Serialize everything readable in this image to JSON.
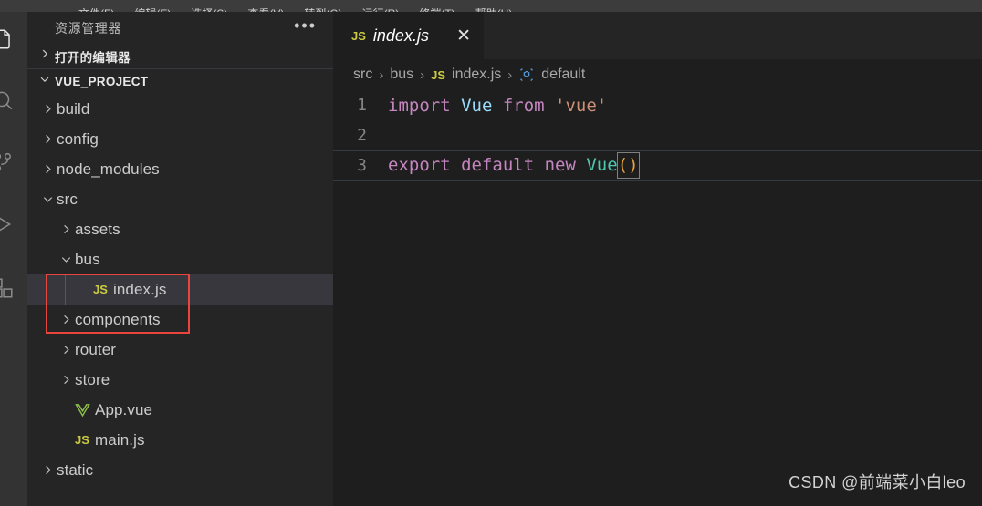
{
  "menubar": {
    "items": [
      "文件(F)",
      "编辑(E)",
      "选择(S)",
      "查看(V)",
      "转到(G)",
      "运行(R)",
      "终端(T)",
      "帮助(H)"
    ]
  },
  "activitybar": {
    "items": [
      {
        "name": "explorer-icon",
        "label": "资源管理器",
        "active": true
      },
      {
        "name": "search-icon",
        "label": "搜索",
        "active": false
      },
      {
        "name": "source-control-icon",
        "label": "源代码管理",
        "active": false
      },
      {
        "name": "run-debug-icon",
        "label": "运行和调试",
        "active": false
      },
      {
        "name": "extensions-icon",
        "label": "扩展",
        "active": false
      }
    ]
  },
  "sidebar": {
    "title": "资源管理器",
    "more_actions": "•••",
    "open_editors": {
      "label": "打开的编辑器",
      "expanded": false
    },
    "project": {
      "label": "VUE_PROJECT",
      "expanded": true
    },
    "tree": [
      {
        "label": "build",
        "type": "folder",
        "expanded": false,
        "depth": 1,
        "selected": false
      },
      {
        "label": "config",
        "type": "folder",
        "expanded": false,
        "depth": 1,
        "selected": false
      },
      {
        "label": "node_modules",
        "type": "folder",
        "expanded": false,
        "depth": 1,
        "selected": false
      },
      {
        "label": "src",
        "type": "folder",
        "expanded": true,
        "depth": 1,
        "selected": false
      },
      {
        "label": "assets",
        "type": "folder",
        "expanded": false,
        "depth": 2,
        "selected": false
      },
      {
        "label": "bus",
        "type": "folder",
        "expanded": true,
        "depth": 2,
        "selected": false
      },
      {
        "label": "index.js",
        "type": "js",
        "depth": 3,
        "selected": true
      },
      {
        "label": "components",
        "type": "folder",
        "expanded": false,
        "depth": 2,
        "selected": false
      },
      {
        "label": "router",
        "type": "folder",
        "expanded": false,
        "depth": 2,
        "selected": false
      },
      {
        "label": "store",
        "type": "folder",
        "expanded": false,
        "depth": 2,
        "selected": false
      },
      {
        "label": "App.vue",
        "type": "vue",
        "depth": 2,
        "selected": false
      },
      {
        "label": "main.js",
        "type": "js",
        "depth": 2,
        "selected": false
      },
      {
        "label": "static",
        "type": "folder",
        "expanded": false,
        "depth": 1,
        "selected": false
      }
    ]
  },
  "editor": {
    "tab": {
      "label": "index.js",
      "filetype_badge": "JS",
      "close": "✕",
      "preview": true
    },
    "breadcrumbs": [
      {
        "label": "src",
        "icon": ""
      },
      {
        "label": "bus",
        "icon": ""
      },
      {
        "label": "index.js",
        "icon": "js-badge"
      },
      {
        "label": "default",
        "icon": "module-cube-icon"
      }
    ],
    "breadcrumb_separator": "›",
    "lines": [
      {
        "number": "1",
        "tokens": [
          {
            "text": "import ",
            "kind": "keyword"
          },
          {
            "text": "Vue ",
            "kind": "variable"
          },
          {
            "text": "from ",
            "kind": "keyword"
          },
          {
            "text": "'vue'",
            "kind": "string"
          }
        ],
        "current": false
      },
      {
        "number": "2",
        "tokens": [],
        "current": false
      },
      {
        "number": "3",
        "tokens": [
          {
            "text": "export ",
            "kind": "keyword"
          },
          {
            "text": "default ",
            "kind": "keyword"
          },
          {
            "text": "new ",
            "kind": "keyword"
          },
          {
            "text": "Vue",
            "kind": "type"
          },
          {
            "text": "()",
            "kind": "bracket-match"
          }
        ],
        "current": true
      }
    ]
  },
  "watermark": "CSDN @前端菜小白leo",
  "colors": {
    "editor_bg": "#1e1e1e",
    "sidebar_bg": "#252526",
    "activitybar_bg": "#333333",
    "selection_bg": "#37373d",
    "annotation": "#e8453c",
    "keyword": "#c586c0",
    "type": "#4ec9b0",
    "variable": "#9cdcfe",
    "string": "#ce9178",
    "js_yellow": "#cbcb41",
    "vue_green": "#8dc149"
  }
}
